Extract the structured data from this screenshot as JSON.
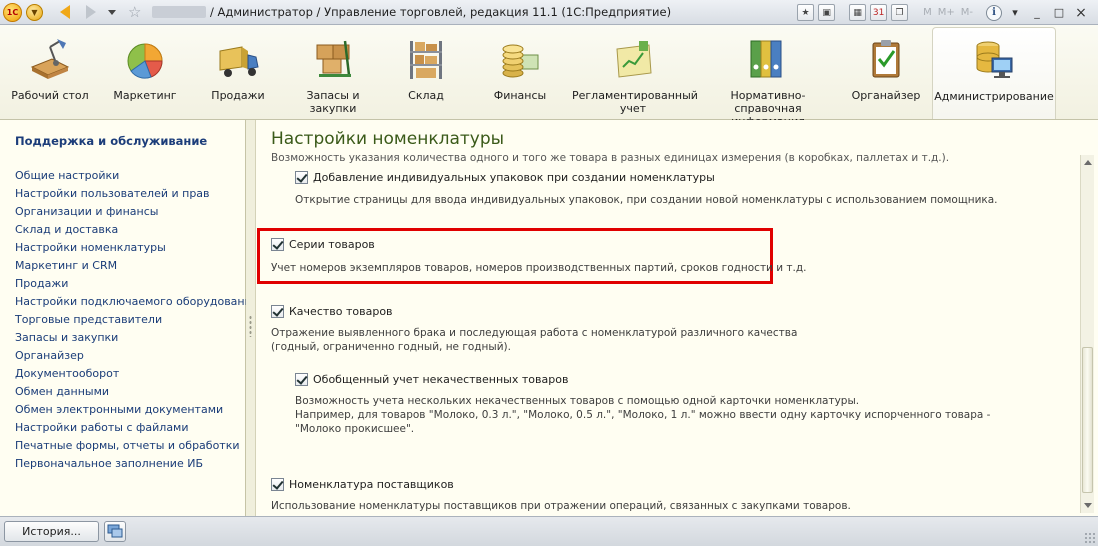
{
  "window": {
    "title": "/ Администратор / Управление торговлей, редакция 11.1  (1С:Предприятие)",
    "logo_text": "1С",
    "menu_icon": "dropdown-menu-icon",
    "toolbar_right": {
      "m": "M",
      "m_plus": "M+",
      "m_minus": "M-",
      "info": "i",
      "min": "_",
      "restore": "□",
      "close": "×"
    }
  },
  "sections": [
    {
      "id": "desktop",
      "label": "Рабочий стол",
      "icon": "desk-lamp-icon"
    },
    {
      "id": "marketing",
      "label": "Маркетинг",
      "icon": "pie-chart-icon"
    },
    {
      "id": "sales",
      "label": "Продажи",
      "icon": "truck-icon"
    },
    {
      "id": "stock",
      "label": "Запасы и закупки",
      "icon": "boxes-cart-icon"
    },
    {
      "id": "warehouse",
      "label": "Склад",
      "icon": "shelves-icon"
    },
    {
      "id": "finance",
      "label": "Финансы",
      "icon": "coins-icon"
    },
    {
      "id": "reports",
      "label": "Регламентированный учет",
      "icon": "folder-chart-icon"
    },
    {
      "id": "refs",
      "label": "Нормативно-справочная информация",
      "icon": "binders-icon"
    },
    {
      "id": "organizer",
      "label": "Органайзер",
      "icon": "clipboard-check-icon"
    },
    {
      "id": "admin",
      "label": "Администрирование",
      "icon": "database-monitor-icon",
      "active": true
    }
  ],
  "left_nav": {
    "heading": "Поддержка и обслуживание",
    "items": [
      "Общие настройки",
      "Настройки пользователей и прав",
      "Организации и финансы",
      "Склад и доставка",
      "Настройки номенклатуры",
      "Маркетинг и CRM",
      "Продажи",
      "Настройки подключаемого оборудования",
      "Торговые представители",
      "Запасы и закупки",
      "Органайзер",
      "Документооборот",
      "Обмен данными",
      "Обмен электронными документами",
      "Настройки работы с файлами",
      "Печатные формы, отчеты и обработки",
      "Первоначальное заполнение ИБ"
    ]
  },
  "main": {
    "title": "Настройки номенклатуры",
    "cut_text": "Возможность указания количества одного и того же товара в разных единицах измерения (в коробках, паллетах и т.д.).",
    "options": {
      "individual_packs": {
        "label": "Добавление индивидуальных упаковок при создании номенклатуры",
        "checked": true,
        "desc": "Открытие страницы для ввода индивидуальных упаковок, при создании новой номенклатуры с использованием помощника."
      },
      "series": {
        "label": "Серии товаров",
        "checked": true,
        "desc": "Учет номеров экземпляров товаров, номеров производственных партий, сроков годности и т.д."
      },
      "quality": {
        "label": "Качество товаров",
        "checked": true,
        "desc1": "Отражение выявленного брака и последующая работа с номенклатурой различного качества",
        "desc2": "(годный, ограниченно годный, не годный)."
      },
      "generalized": {
        "label": "Обобщенный учет некачественных товаров",
        "checked": true,
        "desc1": "Возможность учета нескольких некачественных товаров с помощью одной карточки номенклатуры.",
        "desc2": "Например, для товаров \"Молоко, 0.3 л.\", \"Молоко, 0.5 л.\", \"Молоко, 1 л.\" можно ввести одну карточку испорченного товара -",
        "desc3": "\"Молоко прокисшее\"."
      },
      "supplier_nomenclature": {
        "label": "Номенклатура поставщиков",
        "checked": true,
        "desc": "Использование номенклатуры поставщиков при отражении операций, связанных с закупками товаров."
      }
    }
  },
  "status_bar": {
    "history_label": "История..."
  }
}
